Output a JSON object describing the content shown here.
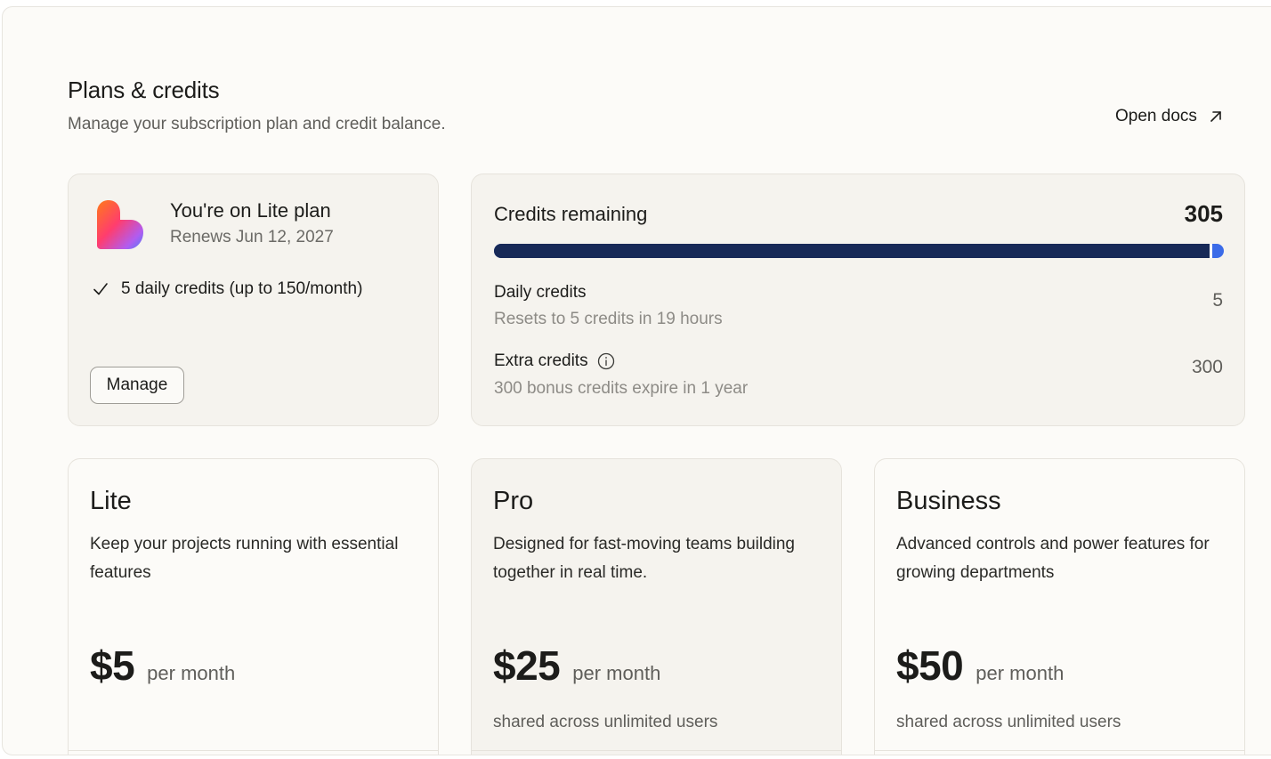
{
  "header": {
    "title": "Plans & credits",
    "subtitle": "Manage your subscription plan and credit balance.",
    "docs_link": "Open docs",
    "docs_icon": "arrow-up-right-icon"
  },
  "current_plan": {
    "name": "You're on Lite plan",
    "renews": "Renews Jun 12, 2027",
    "feature": "5 daily credits (up to 150/month)",
    "feature_icon": "check-icon",
    "manage_label": "Manage",
    "logo_icon": "heart-logo-icon"
  },
  "credits": {
    "title": "Credits remaining",
    "total": "305",
    "progress": {
      "daily_fraction": 0.016,
      "colors": {
        "extra": "#172957",
        "daily": "#3b6be8"
      }
    },
    "daily": {
      "label": "Daily credits",
      "sub": "Resets to 5 credits in 19 hours",
      "value": "5"
    },
    "extra": {
      "label": "Extra credits",
      "sub": "300 bonus credits expire in 1 year",
      "value": "300",
      "info_icon": "info-icon"
    }
  },
  "tiers": [
    {
      "name": "Lite",
      "description": "Keep your projects running with essential features",
      "price": "$5",
      "period": "per month",
      "note": ""
    },
    {
      "name": "Pro",
      "description": "Designed for fast-moving teams building together in real time.",
      "price": "$25",
      "period": "per month",
      "note": "shared across unlimited users"
    },
    {
      "name": "Business",
      "description": "Advanced controls and power features for growing departments",
      "price": "$50",
      "period": "per month",
      "note": "shared across unlimited users"
    }
  ]
}
